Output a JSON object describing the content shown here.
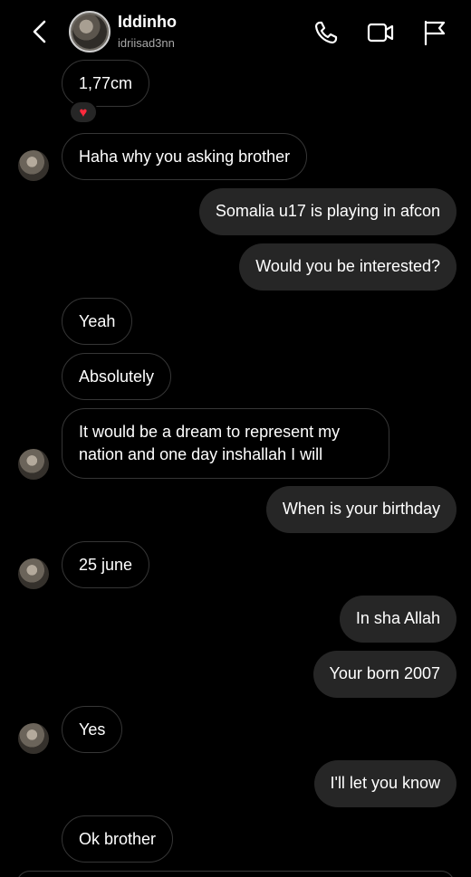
{
  "header": {
    "name": "Iddinho",
    "username": "idriisad3nn"
  },
  "icons": {
    "back": "chevron-left-icon",
    "call": "phone-icon",
    "video": "video-camera-icon",
    "report": "flag-icon",
    "reaction": "heart-icon"
  },
  "reaction": {
    "emoji": "♥"
  },
  "messages": [
    {
      "from": "them",
      "text": "1,77cm"
    },
    {
      "from": "them",
      "text": "Haha why you asking brother"
    },
    {
      "from": "me",
      "text": "Somalia u17 is playing in afcon"
    },
    {
      "from": "me",
      "text": "Would you be interested?"
    },
    {
      "from": "them",
      "text": "Yeah"
    },
    {
      "from": "them",
      "text": "Absolutely"
    },
    {
      "from": "them",
      "text": "It would be a dream to represent my nation and one day inshallah I will"
    },
    {
      "from": "me",
      "text": "When is your birthday"
    },
    {
      "from": "them",
      "text": "25 june"
    },
    {
      "from": "me",
      "text": "In sha Allah"
    },
    {
      "from": "me",
      "text": "Your born 2007"
    },
    {
      "from": "them",
      "text": "Yes"
    },
    {
      "from": "me",
      "text": "I'll let you know"
    },
    {
      "from": "them",
      "text": "Ok brother"
    }
  ],
  "colors": {
    "background": "#000000",
    "outgoing_bubble": "#262626",
    "incoming_border": "#363636",
    "heart": "#ff2a3d"
  }
}
